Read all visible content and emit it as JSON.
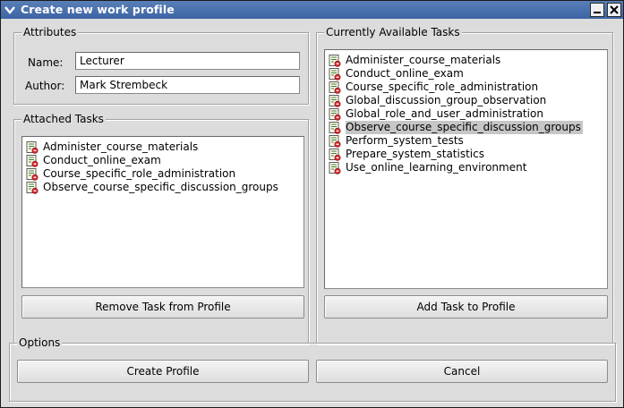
{
  "window": {
    "title": "Create new work profile"
  },
  "attributes": {
    "title": "Attributes",
    "name_label": "Name:",
    "name_value": "Lecturer",
    "author_label": "Author:",
    "author_value": "Mark Strembeck"
  },
  "attached_tasks": {
    "title": "Attached Tasks",
    "items": [
      "Administer_course_materials",
      "Conduct_online_exam",
      "Course_specific_role_administration",
      "Observe_course_specific_discussion_groups"
    ],
    "remove_button": "Remove Task from Profile"
  },
  "available_tasks": {
    "title": "Currently Available Tasks",
    "items": [
      "Administer_course_materials",
      "Conduct_online_exam",
      "Course_specific_role_administration",
      "Global_discussion_group_observation",
      "Global_role_and_user_administration",
      "Observe_course_specific_discussion_groups",
      "Perform_system_tests",
      "Prepare_system_statistics",
      "Use_online_learning_environment"
    ],
    "selected_index": 5,
    "add_button": "Add Task to Profile"
  },
  "options": {
    "title": "Options",
    "create_button": "Create Profile",
    "cancel_button": "Cancel"
  },
  "icons": {
    "window_menu": "chevron-down-icon",
    "minimize": "minimize-icon",
    "close": "close-icon",
    "task": "task-document-icon"
  },
  "colors": {
    "titlebar": "#4a70ae",
    "dialog_bg": "#dcdcdc",
    "selection": "#c6c6c6"
  }
}
